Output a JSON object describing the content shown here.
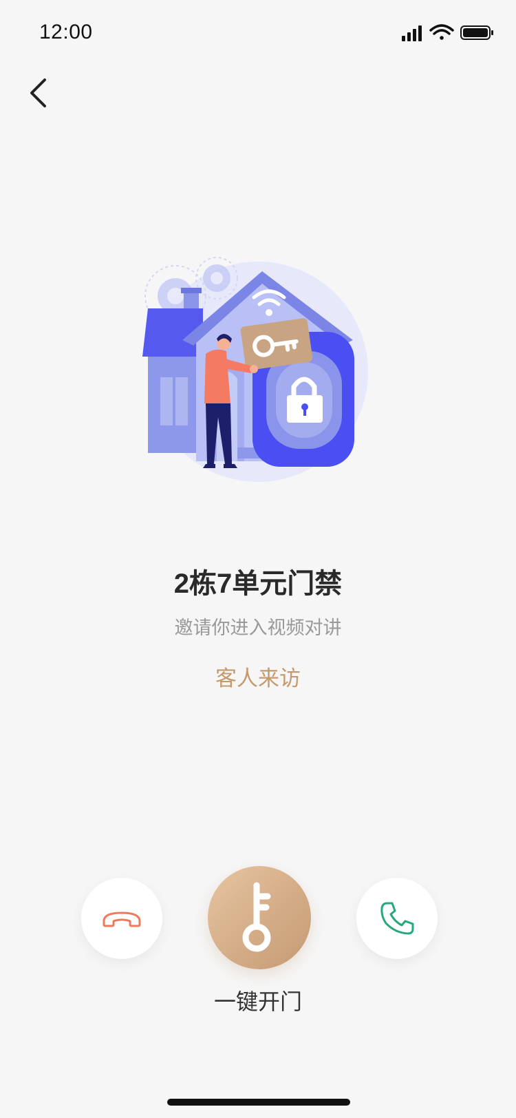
{
  "status_bar": {
    "time": "12:00"
  },
  "intercom": {
    "title": "2栋7单元门禁",
    "subtitle": "邀请你进入视频对讲",
    "visitor": "客人来访"
  },
  "actions": {
    "hangup_icon": "phone-hangup-icon",
    "unlock_icon": "key-icon",
    "answer_icon": "phone-icon",
    "unlock_label": "一键开门"
  },
  "colors": {
    "background": "#f6f6f6",
    "accent_gold": "#c49a6c",
    "hangup_red": "#ec7a5f",
    "answer_green": "#26a87a",
    "illustration_blue": "#4b4ff2"
  }
}
